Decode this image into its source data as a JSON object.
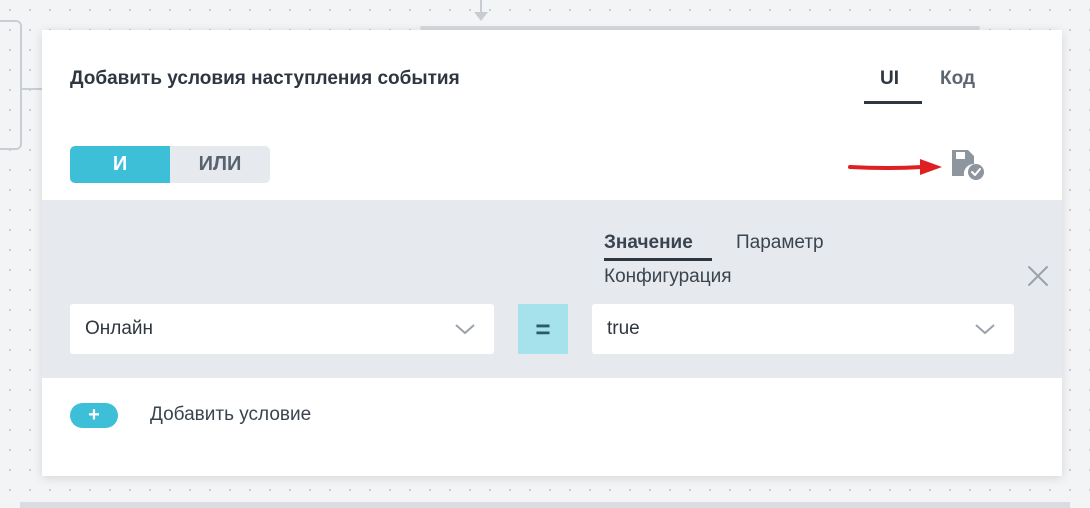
{
  "dialog": {
    "title": "Добавить условия наступления события",
    "mode_tabs": [
      {
        "label": "UI",
        "active": true
      },
      {
        "label": "Код",
        "active": false
      }
    ]
  },
  "logic_toggle": {
    "options": [
      "И",
      "ИЛИ"
    ],
    "selected": "И"
  },
  "condition": {
    "attribute": "Онлайн",
    "operator": "=",
    "value_source_tabs": [
      "Значение",
      "Параметр",
      "Конфигурация"
    ],
    "value_source_selected": "Значение",
    "value": "true"
  },
  "add_condition": {
    "icon": "+",
    "label": "Добавить условие"
  },
  "icons": {
    "save": "save-check-icon",
    "remove": "close-icon",
    "dropdown": "chevron-down-icon",
    "annotation": "red-arrow"
  },
  "colors": {
    "accent": "#3dbfd8",
    "operator_bg": "#a6e2ec",
    "condition_bg": "#e6eaee",
    "annotation_red": "#e02020"
  }
}
